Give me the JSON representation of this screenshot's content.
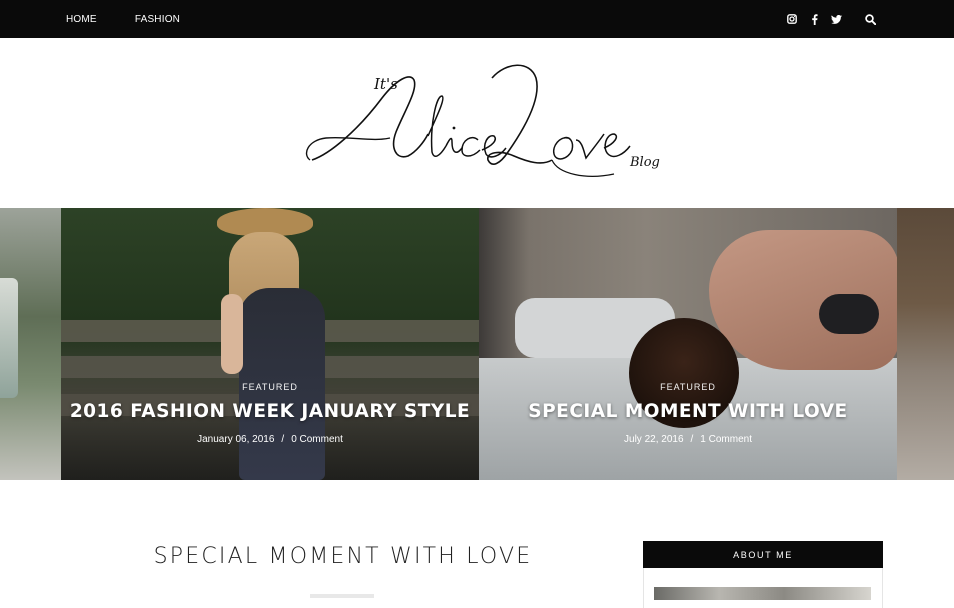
{
  "nav": {
    "items": [
      {
        "label": "HOME"
      },
      {
        "label": "FASHION"
      }
    ]
  },
  "social": {
    "icons": [
      "instagram-icon",
      "facebook-icon",
      "twitter-icon",
      "search-icon"
    ]
  },
  "logo": {
    "prefix": "It's",
    "name_first": "Alice",
    "name_last": "Love",
    "suffix": "Blog"
  },
  "slider": {
    "slides": [
      {
        "category": "FEATURED",
        "title": "2016 FASHION WEEK JANUARY STYLE",
        "date": "January 06, 2016",
        "separator": "/",
        "comments": "0 Comment"
      },
      {
        "category": "FEATURED",
        "title": "SPECIAL MOMENT WITH LOVE",
        "date": "July 22, 2016",
        "separator": "/",
        "comments": "1 Comment"
      }
    ]
  },
  "main": {
    "post_title": "SPECIAL MOMENT WITH LOVE"
  },
  "sidebar": {
    "widget_title": "ABOUT ME"
  },
  "colors": {
    "topbar": "#0a0a0a",
    "text_dark": "#222222",
    "widget_head": "#0a0a0a"
  }
}
